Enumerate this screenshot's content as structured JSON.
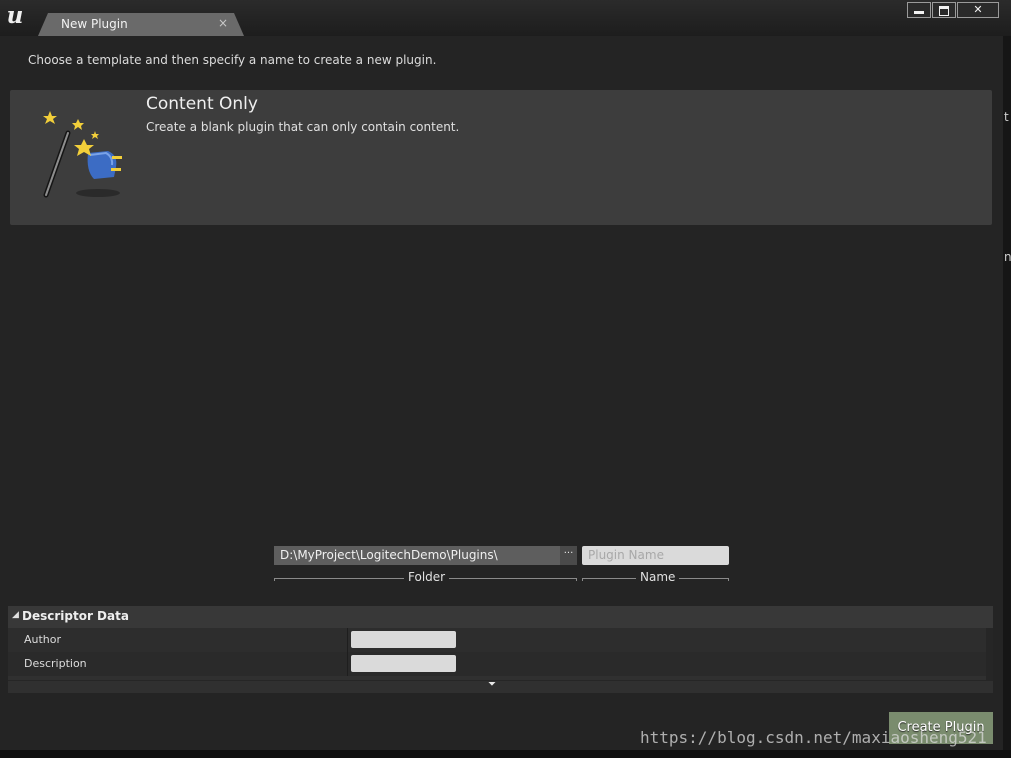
{
  "window": {
    "tab_title": "New Plugin",
    "tab_close": "×",
    "close_glyph": "✕"
  },
  "instruction": "Choose a template and then specify a name to create a new plugin.",
  "template": {
    "title": "Content Only",
    "description": "Create a blank plugin that can only contain content.",
    "icon": "wand-plugin-icon"
  },
  "fields": {
    "folder_value": "D:\\MyProject\\LogitechDemo\\Plugins\\",
    "browse_label": "···",
    "folder_caption": "Folder",
    "name_placeholder": "Plugin Name",
    "name_caption": "Name"
  },
  "descriptor": {
    "title": "Descriptor Data",
    "rows": [
      {
        "label": "Author",
        "value": ""
      },
      {
        "label": "Description",
        "value": ""
      }
    ]
  },
  "create_button": "Create Plugin",
  "watermark": "https://blog.csdn.net/maxiaosheng521",
  "colors": {
    "create_button": "#7a8c6e",
    "template_card": "#3d3d3d"
  }
}
